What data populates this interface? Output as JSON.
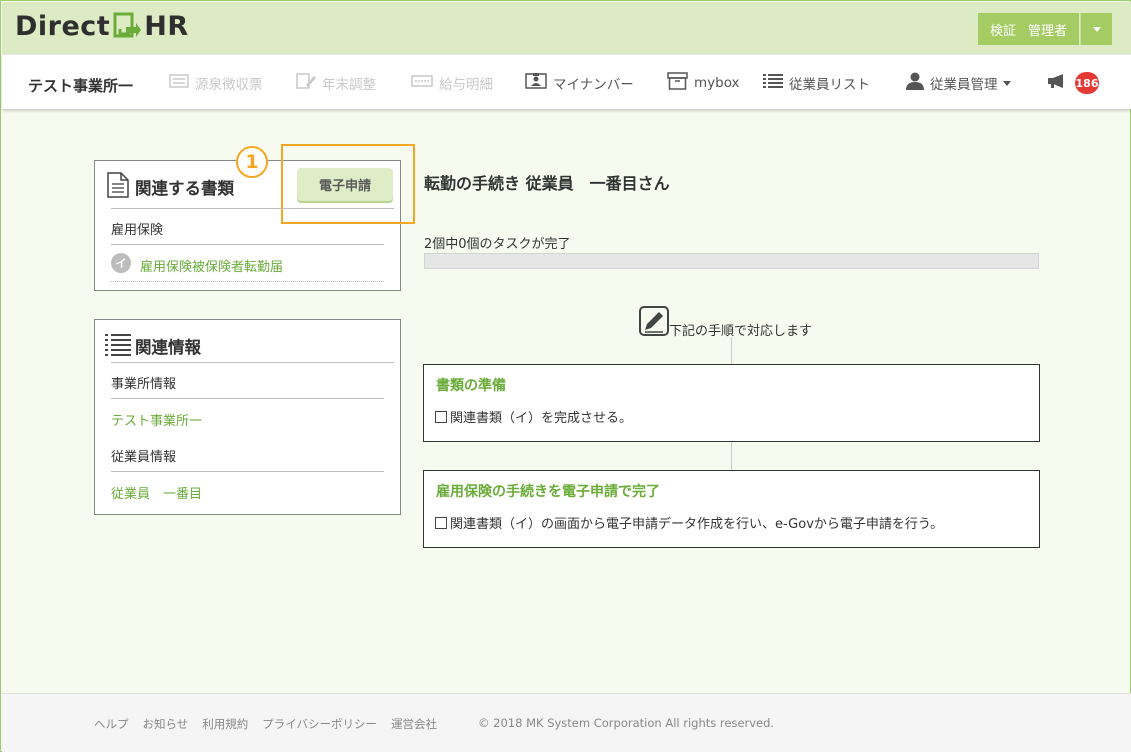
{
  "header": {
    "logo_left": "Direct",
    "logo_right": "HR",
    "admin_verify": "検証",
    "admin_name": "管理者"
  },
  "nav": {
    "office_name": "テスト事業所一",
    "items": [
      {
        "label": "源泉徴収票",
        "icon": "receipt-icon",
        "enabled": false
      },
      {
        "label": "年末調整",
        "icon": "edit-doc-icon",
        "enabled": false
      },
      {
        "label": "給与明細",
        "icon": "payslip-icon",
        "enabled": false
      },
      {
        "label": "マイナンバー",
        "icon": "id-card-icon",
        "enabled": true
      },
      {
        "label": "mybox",
        "icon": "box-icon",
        "enabled": true
      },
      {
        "label": "従業員リスト",
        "icon": "list-icon",
        "enabled": true
      },
      {
        "label": "従業員管理",
        "icon": "user-icon",
        "enabled": true
      }
    ],
    "notification_count": "186"
  },
  "sidebar": {
    "docs": {
      "title": "関連する書類",
      "e_apply_button": "電子申請",
      "annotation_number": "1",
      "category": "雇用保険",
      "doc_marker": "イ",
      "doc_link": "雇用保険被保険者転勤届"
    },
    "info": {
      "title": "関連情報",
      "office_label": "事業所情報",
      "office_link": "テスト事業所一",
      "employee_label": "従業員情報",
      "employee_link": "従業員　一番目"
    }
  },
  "main": {
    "heading": "転勤の手続き  従業員　一番目さん",
    "progress_text": "2個中0個のタスクが完了",
    "progress_fraction": 0,
    "steps_intro": "下記の手順で対応します",
    "tasks": [
      {
        "title": "書類の準備",
        "item": "関連書類（イ）を完成させる。"
      },
      {
        "title": "雇用保険の手続きを電子申請で完了",
        "item": "関連書類（イ）の画面から電子申請データ作成を行い、e-Govから電子申請を行う。"
      }
    ]
  },
  "footer": {
    "links": [
      "ヘルプ",
      "お知らせ",
      "利用規約",
      "プライバシーポリシー",
      "運営会社"
    ],
    "copyright": "© 2018 MK System Corporation All rights reserved."
  },
  "colors": {
    "brand_green": "#6aac3a",
    "header_bg": "#dcebc3",
    "admin_button": "#a4cc62",
    "highlight": "#f5a623",
    "badge": "#e53935"
  }
}
